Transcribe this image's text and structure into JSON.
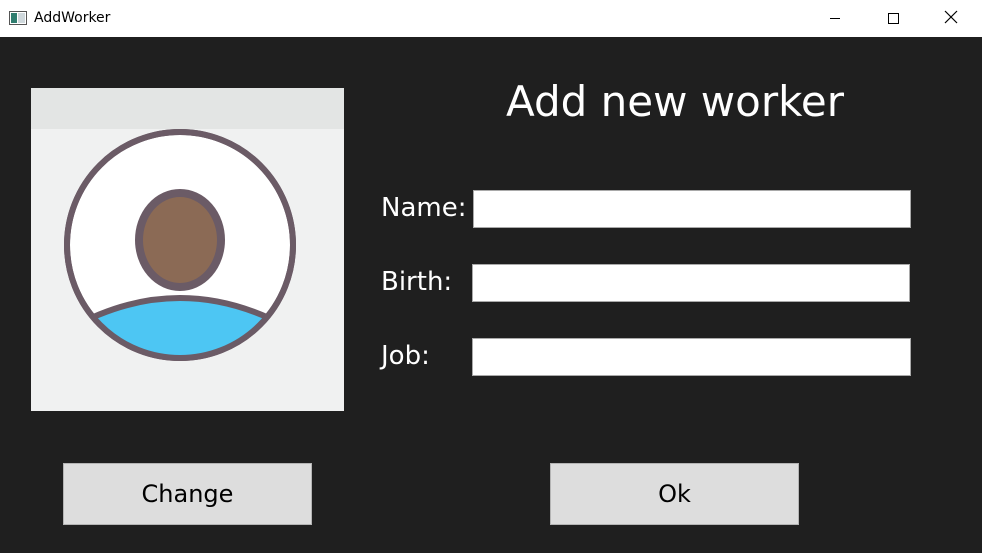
{
  "window": {
    "title": "AddWorker",
    "icon": "app-window-icon",
    "controls": {
      "minimize_icon": "minimize-icon",
      "maximize_icon": "maximize-icon",
      "close_icon": "close-icon"
    }
  },
  "heading": "Add new worker",
  "avatar": {
    "icon": "user-avatar-icon",
    "colors": {
      "outline": "#6b5b66",
      "face": "#8b6a55",
      "shirt": "#4dc6f3",
      "background": "#f0f1f1"
    }
  },
  "form": {
    "name_label": "Name:",
    "name_value": "",
    "birth_label": "Birth:",
    "birth_value": "",
    "job_label": "Job:",
    "job_value": ""
  },
  "buttons": {
    "change_label": "Change",
    "ok_label": "Ok"
  }
}
